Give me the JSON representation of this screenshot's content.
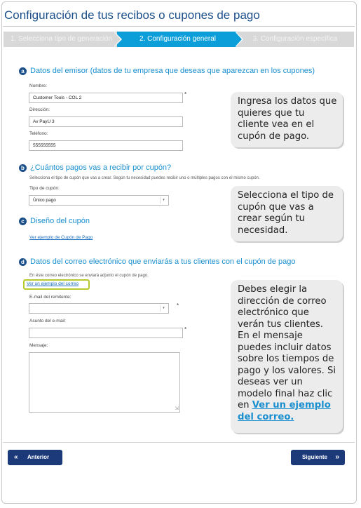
{
  "page_title": "Configuración de tus recibos o cupones de pago",
  "stepper": {
    "step1": "1. Selecciona tipo de generación",
    "step2": "2. Configuración general",
    "step3": "3. Configuración específica",
    "active_step": 2
  },
  "section_a": {
    "badge": "a",
    "title": "Datos del emisor (datos de tu empresa que deseas que aparezcan en los cupones)",
    "name_label": "Nombre:",
    "name_value": "Customer Tools - COL 2",
    "address_label": "Dirección:",
    "address_value": "Av PayU 3",
    "phone_label": "Teléfono:",
    "phone_value": "555555555",
    "required_mark": "*"
  },
  "section_b": {
    "badge": "b",
    "title": "¿Cuántos pagos vas a recibir por cupón?",
    "help": "Selecciona el tipo de cupón que vas a crear. Según tu necesidad puedes recibir uno o múltiples pagos con el mismo cupón.",
    "type_label": "Tipo de cupón:",
    "type_value": "Único pago"
  },
  "section_c": {
    "badge": "c",
    "title": "Diseño del cupón",
    "link": "Ver ejemplo de Cupón de Pago"
  },
  "section_d": {
    "badge": "d",
    "title": "Datos del correo electrónico que enviarás a tus clientes con el cupón de pago",
    "help": "En éste correo electrónico se enviará adjunto el cupón de pago.",
    "link": "Ver un ejemplo del correo",
    "sender_label": "E-mail del remitente:",
    "sender_value": "",
    "subject_label": "Asunto del e-mail:",
    "subject_value": "",
    "message_label": "Mensaje:",
    "required_mark": "*"
  },
  "callouts": {
    "one": "Ingresa los datos que quieres que tu cliente vea en el cupón de pago.",
    "two": "Selecciona el tipo de cupón que vas a crear según tu necesidad.",
    "three_text": "Debes elegir la dirección de correo electrónico que verán tus clientes. En el mensaje puedes incluir datos sobre los tiempos de pago y los valores. Si deseas ver un modelo final haz clic en",
    "three_link": "Ver un ejemplo del correo."
  },
  "footer": {
    "prev_label": "Anterior",
    "next_label": "Siguiente",
    "prev_icon": "double-chevron-left-icon",
    "next_icon": "double-chevron-right-icon"
  },
  "colors": {
    "accent": "#0c9ed9",
    "title": "#1b4f8a",
    "button": "#1c3a7a",
    "highlight": "#b6c92f"
  }
}
